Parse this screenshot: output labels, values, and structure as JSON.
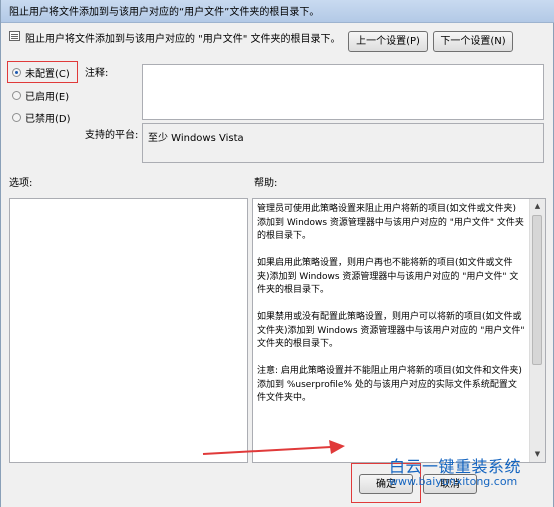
{
  "window": {
    "title": "阻止用户将文件添加到与该用户对应的“用户文件”文件夹的根目录下。"
  },
  "header": {
    "setting_name": "阻止用户将文件添加到与该用户对应的 \"用户文件\" 文件夹的根目录下。",
    "prev_button": "上一个设置(P)",
    "next_button": "下一个设置(N)"
  },
  "state": {
    "options": [
      {
        "label": "未配置(C)",
        "selected": true
      },
      {
        "label": "已启用(E)",
        "selected": false
      },
      {
        "label": "已禁用(D)",
        "selected": false
      }
    ]
  },
  "comment": {
    "label": "注释:",
    "value": ""
  },
  "platform": {
    "label": "支持的平台:",
    "value": "至少 Windows Vista"
  },
  "options_section": {
    "label": "选项:"
  },
  "help_section": {
    "label": "帮助:",
    "paragraphs": [
      "管理员可使用此策略设置来阻止用户将新的项目(如文件或文件夹)添加到 Windows 资源管理器中与该用户对应的 \"用户文件\" 文件夹的根目录下。",
      "如果启用此策略设置，则用户再也不能将新的项目(如文件或文件夹)添加到 Windows 资源管理器中与该用户对应的 \"用户文件\" 文件夹的根目录下。",
      "如果禁用或没有配置此策略设置，则用户可以将新的项目(如文件或文件夹)添加到 Windows 资源管理器中与该用户对应的 \"用户文件\" 文件夹的根目录下。",
      "注意: 启用此策略设置并不能阻止用户将新的项目(如文件和文件夹)添加到 %userprofile% 处的与该用户对应的实际文件系统配置文件文件夹中。"
    ]
  },
  "footer": {
    "ok_button": "确定",
    "cancel_button": "取消"
  },
  "watermark": {
    "brand": "白云一键重装系统",
    "url": "www.baiyunxitong.com"
  },
  "colors": {
    "annotation_red": "#e03a3a",
    "watermark_blue": "#1565c0"
  },
  "icons": {
    "setting": "policy-setting-icon",
    "arrow": "red-annotation-arrow"
  }
}
